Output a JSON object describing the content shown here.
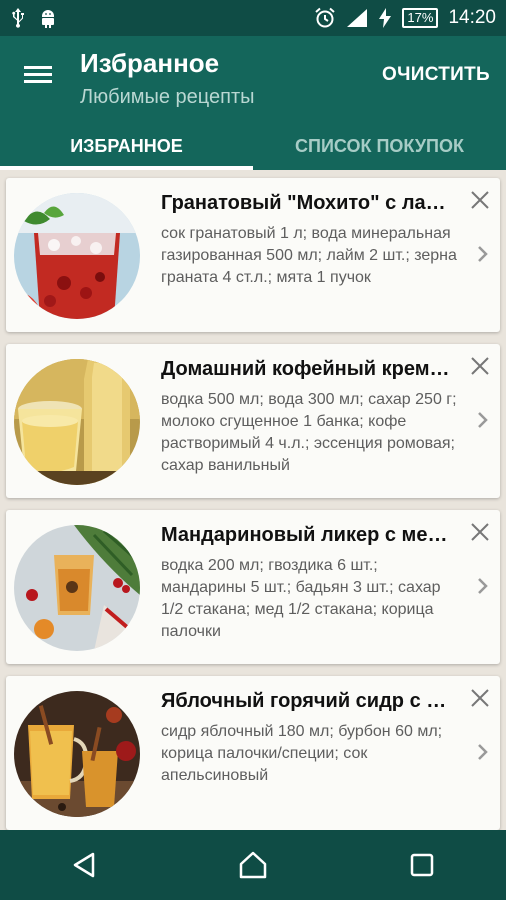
{
  "status_bar": {
    "battery": "17%",
    "time": "14:20",
    "icons": [
      "usb-icon",
      "android-icon",
      "alarm-icon",
      "signal-icon",
      "charging-icon",
      "battery-icon"
    ]
  },
  "app_bar": {
    "title": "Избранное",
    "subtitle": "Любимые рецепты",
    "clear_label": "ОЧИСТИТЬ"
  },
  "tabs": [
    {
      "label": "ИЗБРАННОЕ",
      "active": true
    },
    {
      "label": "СПИСОК ПОКУПОК",
      "active": false
    }
  ],
  "recipes": [
    {
      "title": "Гранатовый \"Мохито\" с лаймом",
      "ingredients": "сок гранатовый 1 л; вода минеральная газированная 500 мл; лайм 2 шт.; зерна граната 4 ст.л.; мята 1 пучок"
    },
    {
      "title": "Домашний кофейный крем-ликер",
      "ingredients": "водка 500 мл; вода 300 мл; сахар 250 г; молоко сгущенное 1 банка; кофе растворимый 4 ч.л.; эссенция ромовая; сахар ванильный"
    },
    {
      "title": "Мандариновый ликер с медом",
      "ingredients": "водка 200 мл; гвоздика 6 шт.; мандарины 5 шт.; бадьян 3 шт.; сахар 1/2 стакана; мед 1/2 стакана; корица палочки"
    },
    {
      "title": "Яблочный горячий сидр с корицей",
      "ingredients": "сидр яблочный 180 мл; бурбон 60 мл; корица палочки/специи; сок апельсиновый"
    }
  ],
  "colors": {
    "status_bar": "#0f4c45",
    "app_bar": "#14665b",
    "background": "#e9e4dc",
    "card": "#fbfbf8"
  }
}
